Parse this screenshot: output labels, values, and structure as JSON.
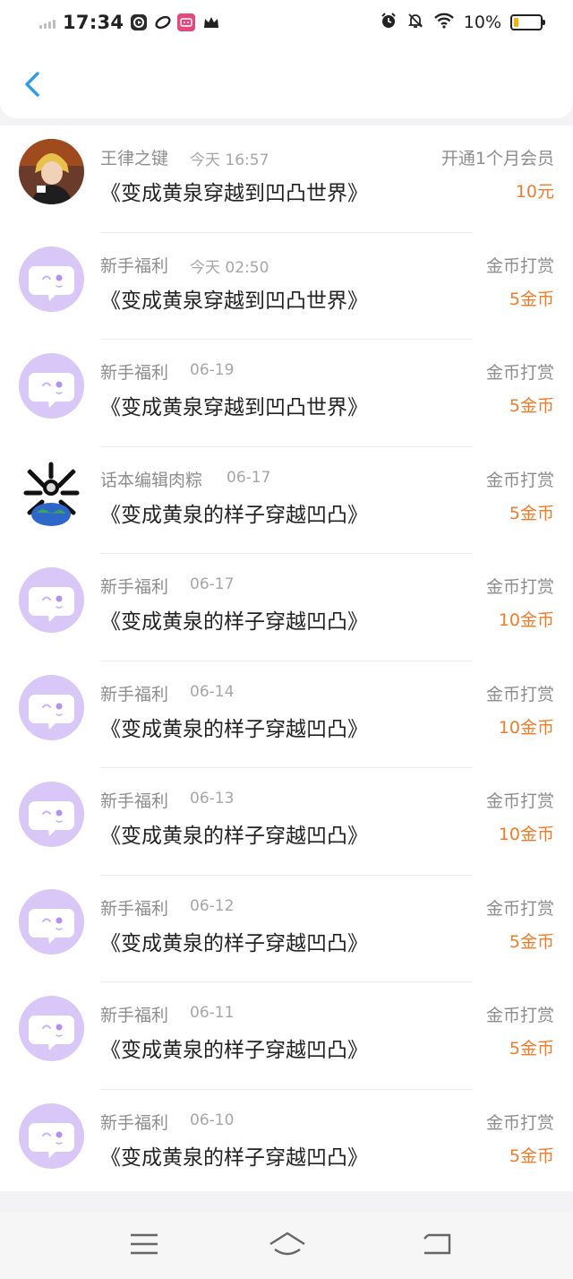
{
  "status_bar": {
    "time": "17:34",
    "battery_percent": "10%",
    "battery_level": 0.1,
    "icons": [
      "signal-icon",
      "record-icon",
      "link-icon",
      "bilibili-icon",
      "crown-icon",
      "alarm-icon",
      "mute-icon",
      "wifi-icon",
      "battery-icon"
    ]
  },
  "header": {
    "back_icon": "chevron-left-icon"
  },
  "colors": {
    "accent_blue": "#2e9bea",
    "amount_orange": "#f07c2a",
    "avatar_purple": "#d9c7f7"
  },
  "records": [
    {
      "user": "王律之键",
      "time": "今天 16:57",
      "book": "《变成黄泉穿越到凹凸世界》",
      "type": "开通1个月会员",
      "amount": "10元",
      "avatar": "photo"
    },
    {
      "user": "新手福利",
      "time": "今天 02:50",
      "book": "《变成黄泉穿越到凹凸世界》",
      "type": "金币打赏",
      "amount": "5金币",
      "avatar": "bubble"
    },
    {
      "user": "新手福利",
      "time": "06-19",
      "book": "《变成黄泉穿越到凹凸世界》",
      "type": "金币打赏",
      "amount": "5金币",
      "avatar": "bubble"
    },
    {
      "user": "话本编辑肉粽",
      "time": "06-17",
      "book": "《变成黄泉的样子穿越凹凸》",
      "type": "金币打赏",
      "amount": "5金币",
      "avatar": "globe"
    },
    {
      "user": "新手福利",
      "time": "06-17",
      "book": "《变成黄泉的样子穿越凹凸》",
      "type": "金币打赏",
      "amount": "10金币",
      "avatar": "bubble"
    },
    {
      "user": "新手福利",
      "time": "06-14",
      "book": "《变成黄泉的样子穿越凹凸》",
      "type": "金币打赏",
      "amount": "10金币",
      "avatar": "bubble"
    },
    {
      "user": "新手福利",
      "time": "06-13",
      "book": "《变成黄泉的样子穿越凹凸》",
      "type": "金币打赏",
      "amount": "10金币",
      "avatar": "bubble"
    },
    {
      "user": "新手福利",
      "time": "06-12",
      "book": "《变成黄泉的样子穿越凹凸》",
      "type": "金币打赏",
      "amount": "5金币",
      "avatar": "bubble"
    },
    {
      "user": "新手福利",
      "time": "06-11",
      "book": "《变成黄泉的样子穿越凹凸》",
      "type": "金币打赏",
      "amount": "5金币",
      "avatar": "bubble"
    },
    {
      "user": "新手福利",
      "time": "06-10",
      "book": "《变成黄泉的样子穿越凹凸》",
      "type": "金币打赏",
      "amount": "5金币",
      "avatar": "bubble"
    }
  ],
  "bottom_nav": [
    "menu-icon",
    "home-icon",
    "back-icon"
  ]
}
